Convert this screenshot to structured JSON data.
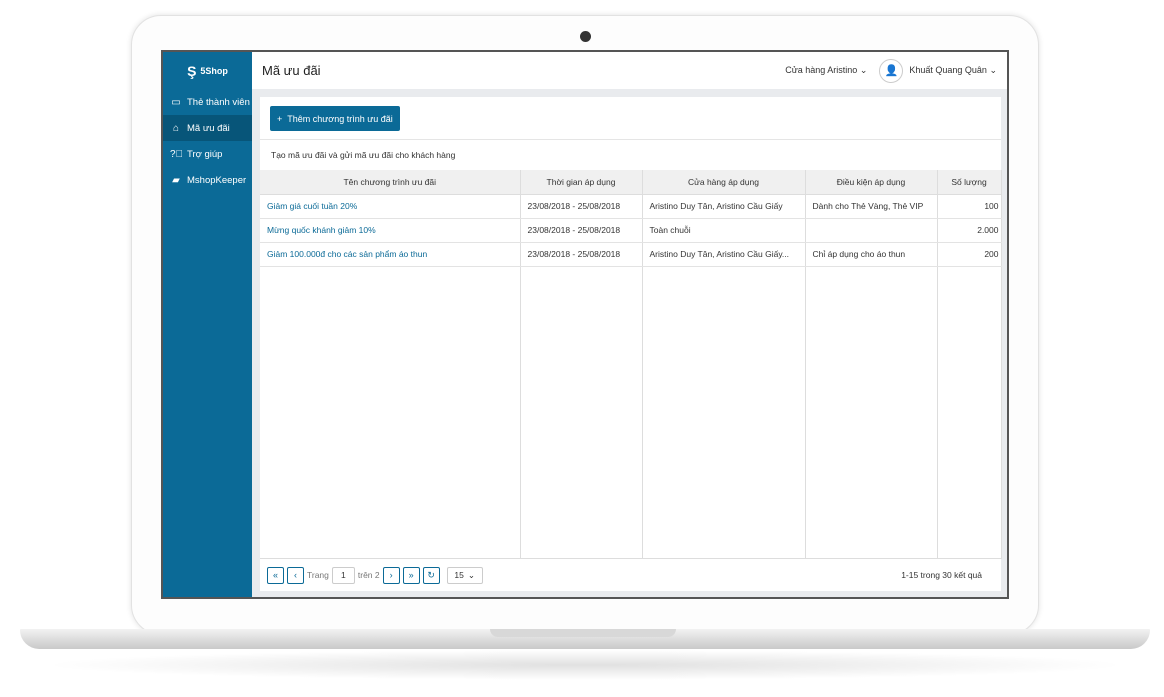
{
  "app": {
    "logo": "5Shop",
    "page_title": "Mã ưu đãi",
    "store": "Cửa hàng Aristino",
    "user": "Khuất Quang Quân"
  },
  "sidebar": {
    "items": [
      {
        "label": "Thẻ thành viên",
        "icon": "card-icon"
      },
      {
        "label": "Mã ưu đãi",
        "icon": "tag-icon",
        "active": true
      },
      {
        "label": "Trợ giúp",
        "icon": "help-icon"
      },
      {
        "label": "MshopKeeper",
        "icon": "bag-icon"
      }
    ]
  },
  "main": {
    "add_button": "Thêm chương trình ưu đãi",
    "description": "Tạo mã ưu đãi và gửi mã ưu đãi cho khách hàng",
    "columns": [
      "Tên chương trình ưu đãi",
      "Thời gian áp dụng",
      "Cửa hàng áp dụng",
      "Điều kiện áp dụng",
      "Số lượng"
    ],
    "rows": [
      [
        "Giảm giá cuối tuần 20%",
        "23/08/2018 - 25/08/2018",
        "Aristino Duy Tân, Aristino Cầu Giấy",
        "Dành cho Thẻ Vàng, Thẻ VIP",
        "100"
      ],
      [
        "Mừng quốc khánh giảm 10%",
        "23/08/2018 - 25/08/2018",
        "Toàn chuỗi",
        "",
        "2.000"
      ],
      [
        "Giảm 100.000đ cho các sản phẩm áo thun",
        "23/08/2018 - 25/08/2018",
        "Aristino Duy Tân, Aristino Cầu Giấy...",
        "Chỉ áp dụng cho áo thun",
        "200"
      ]
    ]
  },
  "pager": {
    "page_label": "Trang",
    "page": "1",
    "of_label": "trên 2",
    "page_size": "15",
    "result": "1-15 trong 30 kết quả"
  },
  "colors": {
    "primary": "#0b6a97",
    "active": "#075579"
  }
}
